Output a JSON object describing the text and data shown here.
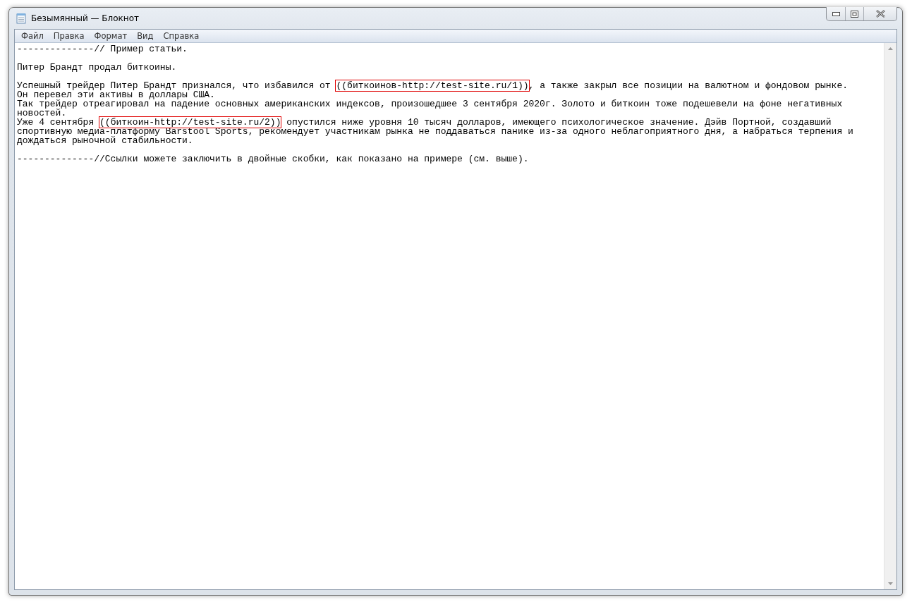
{
  "window": {
    "title": "Безымянный — Блокнот"
  },
  "menu": [
    "Файл",
    "Правка",
    "Формат",
    "Вид",
    "Справка"
  ],
  "editor": {
    "lines": [
      {
        "kind": "text",
        "segments": [
          {
            "text": "--------------// Пример статьи.",
            "highlighted": false
          }
        ]
      },
      {
        "kind": "blank"
      },
      {
        "kind": "text",
        "segments": [
          {
            "text": "Питер Брандт продал биткоины.",
            "highlighted": false
          }
        ]
      },
      {
        "kind": "blank"
      },
      {
        "kind": "text",
        "segments": [
          {
            "text": "Успешный трейдер Питер Брандт признался, что избавился от ",
            "highlighted": false
          },
          {
            "text": "((биткоинов-http://test-site.ru/1))",
            "highlighted": true
          },
          {
            "text": ", а также закрыл все позиции на валютном и фондовом рынке.",
            "highlighted": false
          }
        ]
      },
      {
        "kind": "text",
        "segments": [
          {
            "text": "Он перевел эти активы в доллары США.",
            "highlighted": false
          }
        ]
      },
      {
        "kind": "text",
        "segments": [
          {
            "text": "Так трейдер отреагировал на падение основных американских индексов, произошедшее 3 сентября 2020г. Золото и биткоин тоже подешевели на фоне негативных",
            "highlighted": false
          }
        ]
      },
      {
        "kind": "text",
        "segments": [
          {
            "text": "новостей.",
            "highlighted": false
          }
        ]
      },
      {
        "kind": "text",
        "segments": [
          {
            "text": "Уже 4 сентября ",
            "highlighted": false
          },
          {
            "text": "((биткоин-http://test-site.ru/2))",
            "highlighted": true
          },
          {
            "text": " опустился ниже уровня 10 тысяч долларов, имеющего психологическое значение. Дэйв Портной, создавший",
            "highlighted": false
          }
        ]
      },
      {
        "kind": "text",
        "segments": [
          {
            "text": "спортивную медиа-платформу Barstool Sports, рекомендует участникам рынка не поддаваться панике из-за одного неблагоприятного дня, а набраться терпения и",
            "highlighted": false
          }
        ]
      },
      {
        "kind": "text",
        "segments": [
          {
            "text": "дождаться рыночной стабильности.",
            "highlighted": false
          }
        ]
      },
      {
        "kind": "blank"
      },
      {
        "kind": "text",
        "segments": [
          {
            "text": "--------------//Ссылки можете заключить в двойные скобки, как показано на примере (см. выше).",
            "highlighted": false
          }
        ]
      }
    ]
  }
}
